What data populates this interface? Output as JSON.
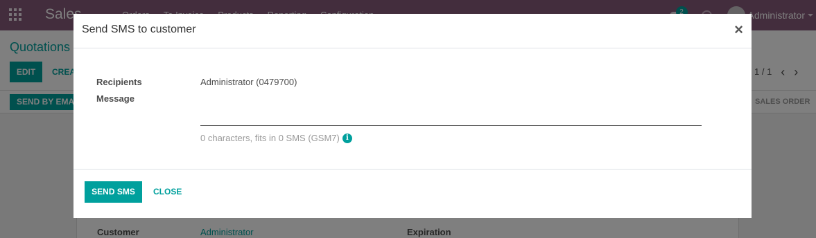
{
  "app": {
    "brand": "Sales",
    "menu": [
      "Orders",
      "To Invoice",
      "Products",
      "Reporting",
      "Configuration"
    ],
    "user": "Administrator",
    "chat_badge": "2"
  },
  "control_panel": {
    "breadcrumb": "Quotations",
    "edit_label": "EDIT",
    "create_label": "CREATE",
    "pager": "1 / 1"
  },
  "statusbar": {
    "send_email_label": "SEND BY EMAIL",
    "stage": "SALES ORDER"
  },
  "form": {
    "customer_label": "Customer",
    "customer_value": "Administrator",
    "expiration_label": "Expiration"
  },
  "modal": {
    "title": "Send SMS to customer",
    "close_glyph": "×",
    "recipients_label": "Recipients",
    "recipients_value": "Administrator (0479700)",
    "message_label": "Message",
    "message_value": "",
    "sms_info": "0 characters, fits in 0 SMS (GSM7)",
    "send_label": "SEND SMS",
    "close_label": "CLOSE"
  },
  "colors": {
    "navbar": "#875a7b",
    "primary": "#00a09d"
  }
}
